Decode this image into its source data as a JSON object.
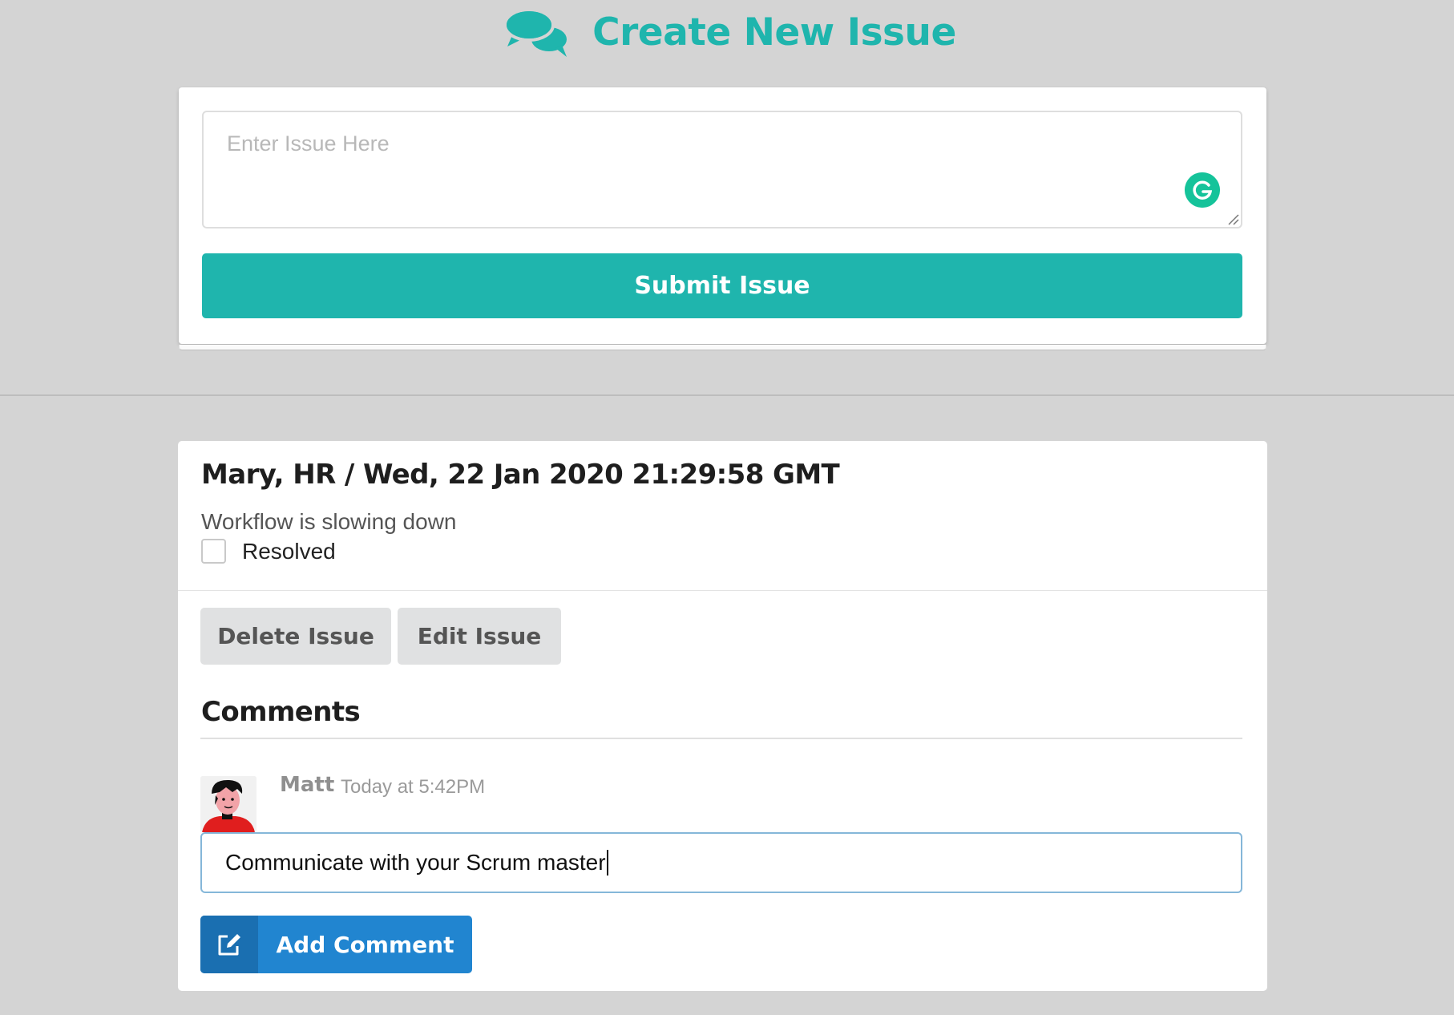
{
  "header": {
    "title": "Create New Issue",
    "icon": "chat-bubbles-icon",
    "accent_color": "#1fb5ad"
  },
  "new_issue": {
    "placeholder": "Enter Issue Here",
    "submit_label": "Submit Issue"
  },
  "issue": {
    "meta": "Mary, HR / Wed, 22 Jan 2020 21:29:58 GMT",
    "description": "Workflow is slowing down",
    "resolved_label": "Resolved",
    "resolved_checked": false,
    "delete_label": "Delete Issue",
    "edit_label": "Edit Issue"
  },
  "comments": {
    "heading": "Comments",
    "items": [
      {
        "author": "Matt",
        "time": "Today at 5:42PM"
      }
    ],
    "input_value": "Communicate with your Scrum master",
    "add_label": "Add Comment",
    "add_icon": "edit-icon",
    "button_color": "#2185d0"
  }
}
